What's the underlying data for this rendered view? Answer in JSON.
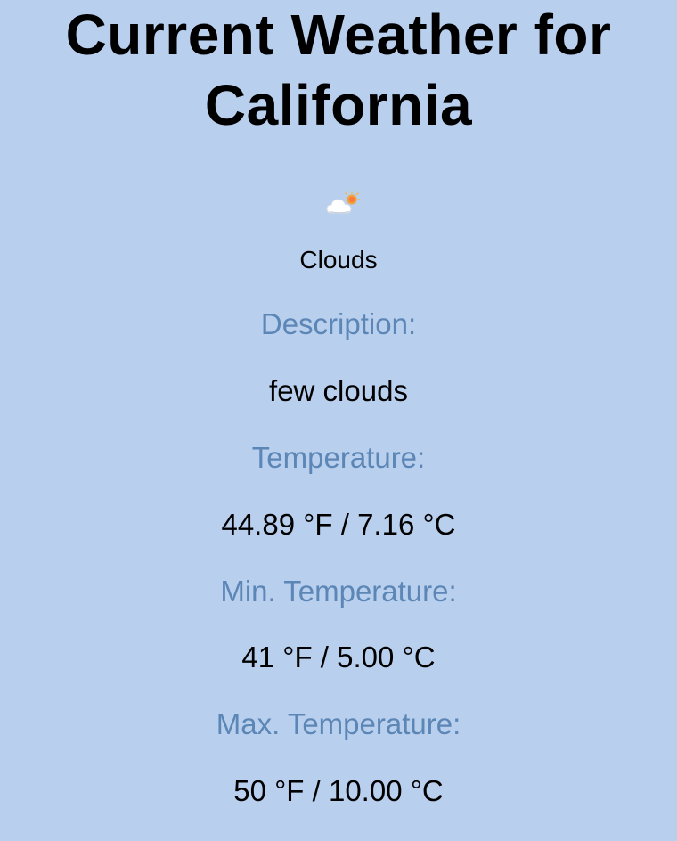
{
  "header": {
    "title_line1": "Current Weather for",
    "title_line2": "California"
  },
  "weather": {
    "icon": "cloud-sun-icon",
    "main": "Clouds",
    "description_label": "Description:",
    "description": "few clouds",
    "temperature_label": "Temperature:",
    "temperature": "44.89 °F / 7.16 °C",
    "min_label": "Min. Temperature:",
    "min": "41 °F / 5.00 °C",
    "max_label": "Max. Temperature:",
    "max": "50 °F / 10.00 °C"
  },
  "colors": {
    "background": "#b9cfee",
    "label": "#5b86b5",
    "text": "#000000"
  }
}
